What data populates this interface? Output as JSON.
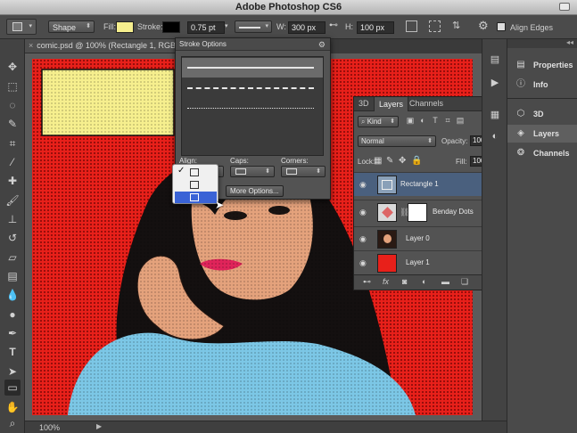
{
  "app": {
    "title": "Adobe Photoshop CS6"
  },
  "options_bar": {
    "mode": "Shape",
    "fill_label": "Fill:",
    "fill_color": "#f6ef8e",
    "stroke_label": "Stroke:",
    "stroke_color": "#000000",
    "stroke_width": "0.75 pt",
    "width_label": "W:",
    "width_value": "300 px",
    "height_label": "H:",
    "height_value": "100 px",
    "align_edges_label": "Align Edges",
    "align_edges_checked": true
  },
  "document": {
    "tab_title": "comic.psd @ 100% (Rectangle 1, RGB",
    "zoom": "100%",
    "background_color": "#e8201a",
    "caption_box_color": "#f6ef8e"
  },
  "stroke_options": {
    "title": "Stroke Options",
    "styles": [
      "solid",
      "dashed",
      "dotted"
    ],
    "selected_style": "solid",
    "align_label": "Align:",
    "caps_label": "Caps:",
    "corners_label": "Corners:",
    "more_options_label": "More Options..."
  },
  "align_popup": {
    "items": [
      {
        "checked": true,
        "highlighted": false
      },
      {
        "checked": false,
        "highlighted": false
      },
      {
        "checked": false,
        "highlighted": true
      }
    ]
  },
  "layers_panel": {
    "tabs": [
      "3D",
      "Layers",
      "Channels"
    ],
    "active_tab": "Layers",
    "filter_label": "Kind",
    "blend_mode": "Normal",
    "opacity_label": "Opacity:",
    "opacity_value": "100%",
    "lock_label": "Lock:",
    "fill_label": "Fill:",
    "fill_value": "100%",
    "layers": [
      {
        "name": "Rectangle 1",
        "selected": true
      },
      {
        "name": "Benday Dots",
        "selected": false
      },
      {
        "name": "Layer 0",
        "selected": false
      },
      {
        "name": "Layer 1",
        "selected": false,
        "thumb_color": "#e8201a"
      }
    ]
  },
  "dock": {
    "groups": [
      {
        "items": [
          {
            "label": "Properties",
            "icon": "properties-icon"
          },
          {
            "label": "Info",
            "icon": "info-icon"
          }
        ]
      },
      {
        "items": [
          {
            "label": "3D",
            "icon": "3d-cube-icon"
          },
          {
            "label": "Layers",
            "icon": "layers-icon",
            "active": true
          },
          {
            "label": "Channels",
            "icon": "channels-icon"
          }
        ]
      }
    ]
  }
}
